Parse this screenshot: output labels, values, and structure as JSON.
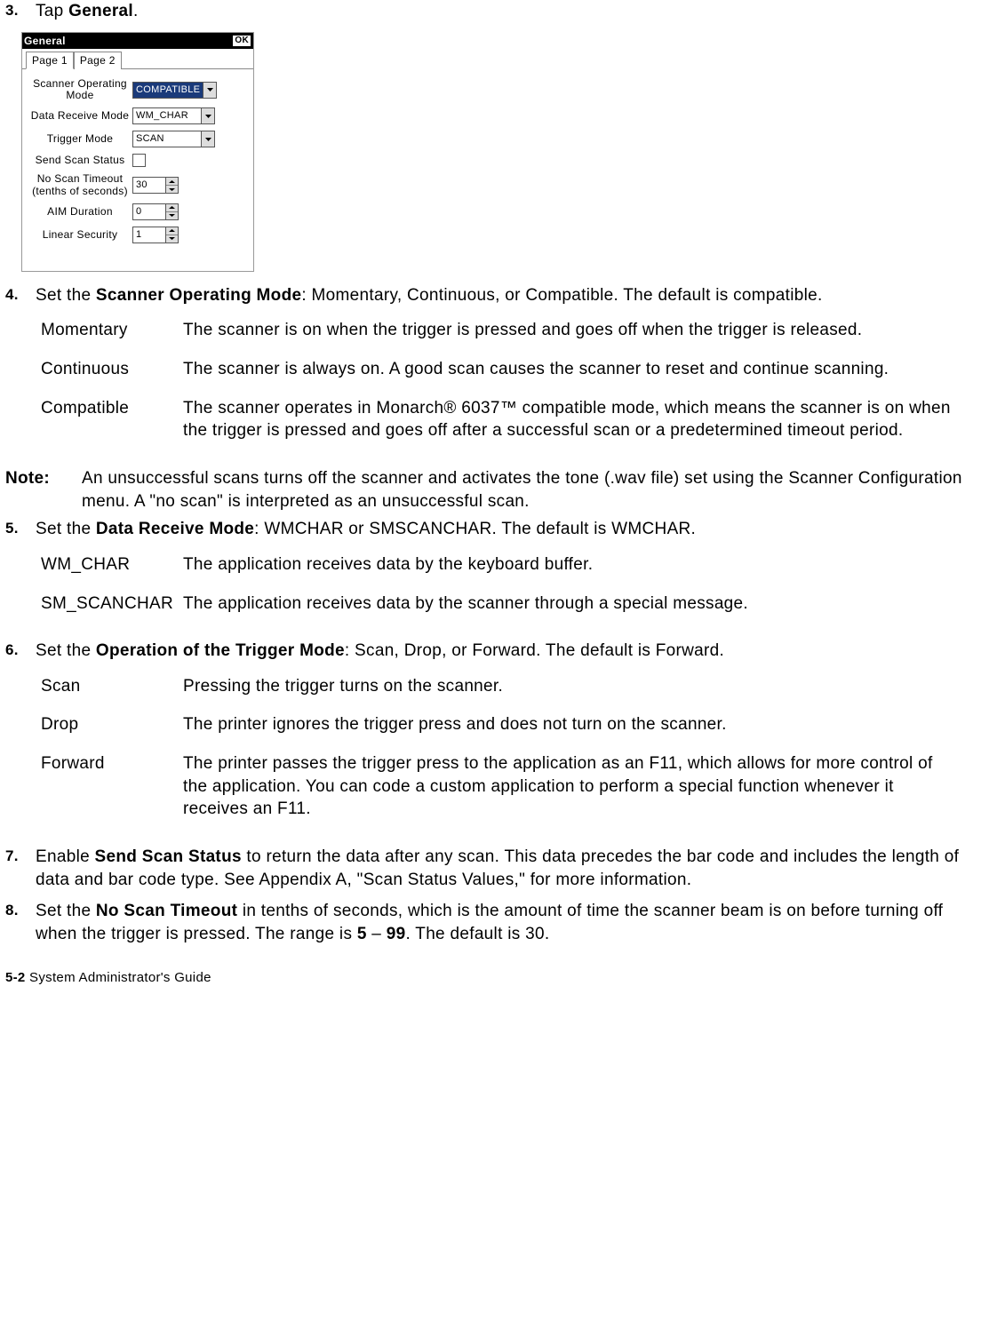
{
  "step3": {
    "num": "3.",
    "text_before": "Tap ",
    "bold": "General",
    "text_after": "."
  },
  "screenshot": {
    "title": "General",
    "ok": "OK",
    "tab1": "Page 1",
    "tab2": "Page 2",
    "rows": {
      "scanner_op_label": "Scanner Operating Mode",
      "scanner_op_value": "COMPATIBLE",
      "data_recv_label": "Data Receive Mode",
      "data_recv_value": "WM_CHAR",
      "trigger_label": "Trigger Mode",
      "trigger_value": "SCAN",
      "send_scan_label": "Send Scan Status",
      "no_scan_label": "No Scan Timeout (tenths of seconds)",
      "no_scan_value": "30",
      "aim_label": "AIM Duration",
      "aim_value": "0",
      "linear_label": "Linear Security",
      "linear_value": "1"
    }
  },
  "step4": {
    "num": "4.",
    "pre": "Set the ",
    "bold": "Scanner Operating Mode",
    "post": ":  Momentary, Continuous, or Compatible.  The default is compatible.",
    "defs": [
      {
        "term": "Momentary",
        "desc": "The scanner is on when the trigger is pressed and goes off when the trigger is released."
      },
      {
        "term": "Continuous",
        "desc": "The scanner is always on.  A good scan causes the scanner to reset and continue scanning."
      },
      {
        "term": "Compatible",
        "desc": "The scanner operates in Monarch® 6037™ compatible mode, which means the scanner is on when the trigger is pressed and goes off after a successful scan or a predetermined timeout period."
      }
    ]
  },
  "note": {
    "label": "Note:",
    "text": "An unsuccessful scans turns off the scanner and activates the tone (.wav file) set using the Scanner Configuration menu.  A \"no scan\" is interpreted as an unsuccessful scan."
  },
  "step5": {
    "num": "5.",
    "pre": "Set the ",
    "bold": "Data Receive Mode",
    "post": ":  WMCHAR or SMSCANCHAR.  The default is WMCHAR.",
    "defs": [
      {
        "term": "WM_CHAR",
        "desc": "The application receives data by the keyboard buffer."
      },
      {
        "term": "SM_SCANCHAR",
        "desc": "The application receives data by the scanner through a special message."
      }
    ]
  },
  "step6": {
    "num": "6.",
    "pre": "Set the ",
    "bold": "Operation of the Trigger Mode",
    "post": ":  Scan, Drop, or Forward.  The default is Forward.",
    "defs": [
      {
        "term": "Scan",
        "desc": "Pressing the trigger turns on the scanner."
      },
      {
        "term": "Drop",
        "desc": "The printer ignores the trigger press and does not turn on the scanner."
      },
      {
        "term": "Forward",
        "desc": "The printer passes the trigger press to the application as an F11, which allows for more control of the application.  You can code a custom application to perform a special function whenever it receives an F11."
      }
    ]
  },
  "step7": {
    "num": "7.",
    "pre": "Enable ",
    "bold": "Send Scan Status",
    "post": " to return the data after any scan.  This data precedes the bar code and includes the length of data and bar code type.  See Appendix A, \"Scan Status Values,\" for more information."
  },
  "step8": {
    "num": "8.",
    "pre": "Set the ",
    "bold": "No Scan Timeout",
    "mid": " in tenths of seconds, which is the amount of time the scanner beam is on before turning off when the trigger is pressed.  The range is ",
    "range1": "5",
    "dash": " – ",
    "range2": "99",
    "post": ".  The default is 30."
  },
  "footer": {
    "page": "5-2",
    "title": "  System Administrator's Guide"
  }
}
